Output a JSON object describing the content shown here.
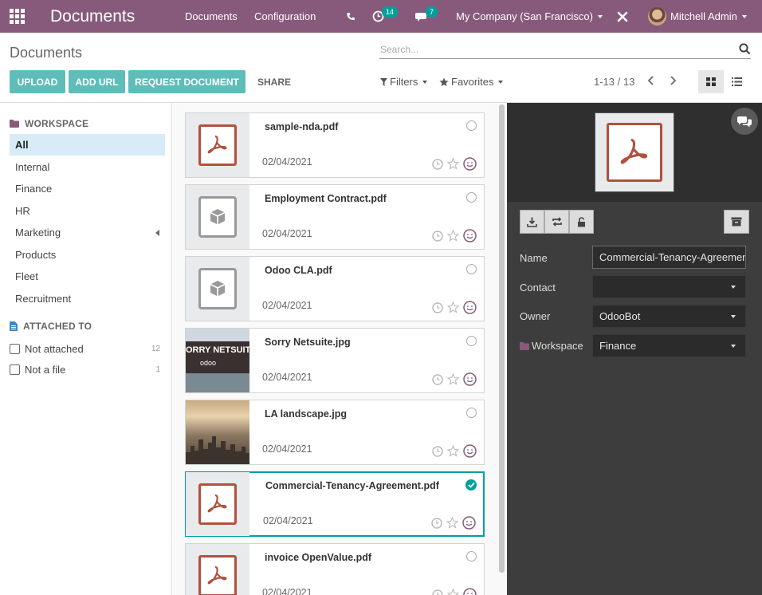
{
  "navbar": {
    "brand": "Documents",
    "menu": [
      "Documents",
      "Configuration"
    ],
    "activity_count": "14",
    "message_count": "7",
    "company": "My Company (San Francisco)",
    "user": "Mitchell Admin",
    "bg_color": "#875a7b"
  },
  "control_panel": {
    "title": "Documents",
    "search_placeholder": "Search...",
    "buttons": {
      "upload": "UPLOAD",
      "add_url": "ADD URL",
      "request": "REQUEST DOCUMENT",
      "share": "SHARE"
    },
    "filters": "Filters",
    "favorites": "Favorites",
    "pager": "1-13 / 13"
  },
  "sidebar": {
    "workspace_heading": "WORKSPACE",
    "workspaces": [
      "All",
      "Internal",
      "Finance",
      "HR",
      "Marketing",
      "Products",
      "Fleet",
      "Recruitment"
    ],
    "active_workspace": "All",
    "attached_heading": "ATTACHED TO",
    "attached": [
      {
        "label": "Not attached",
        "count": "12"
      },
      {
        "label": "Not a file",
        "count": "1"
      }
    ]
  },
  "cards": [
    {
      "name": "sample-nda.pdf",
      "date": "02/04/2021",
      "kind": "pdf",
      "selected": false
    },
    {
      "name": "Employment Contract.pdf",
      "date": "02/04/2021",
      "kind": "box",
      "selected": false
    },
    {
      "name": "Odoo CLA.pdf",
      "date": "02/04/2021",
      "kind": "box",
      "selected": false
    },
    {
      "name": "Sorry Netsuite.jpg",
      "date": "02/04/2021",
      "kind": "billboard",
      "selected": false,
      "image_text": "ORRY NETSUIT",
      "image_brand": "odoo"
    },
    {
      "name": "LA landscape.jpg",
      "date": "02/04/2021",
      "kind": "city",
      "selected": false
    },
    {
      "name": "Commercial-Tenancy-Agreement.pdf",
      "date": "02/04/2021",
      "kind": "pdf",
      "selected": true
    },
    {
      "name": "invoice OpenValue.pdf",
      "date": "02/04/2021",
      "kind": "pdf",
      "selected": false
    }
  ],
  "preview": {
    "fields": {
      "name_label": "Name",
      "name_value": "Commercial-Tenancy-Agreement.pdf",
      "contact_label": "Contact",
      "contact_value": "",
      "owner_label": "Owner",
      "owner_value": "OdooBot",
      "workspace_label": "Workspace",
      "workspace_value": "Finance"
    }
  },
  "colors": {
    "accent": "#00a09d",
    "button": "#5fbdb9",
    "pdf": "#b1513e",
    "panel_dark": "#3d3d3d"
  }
}
